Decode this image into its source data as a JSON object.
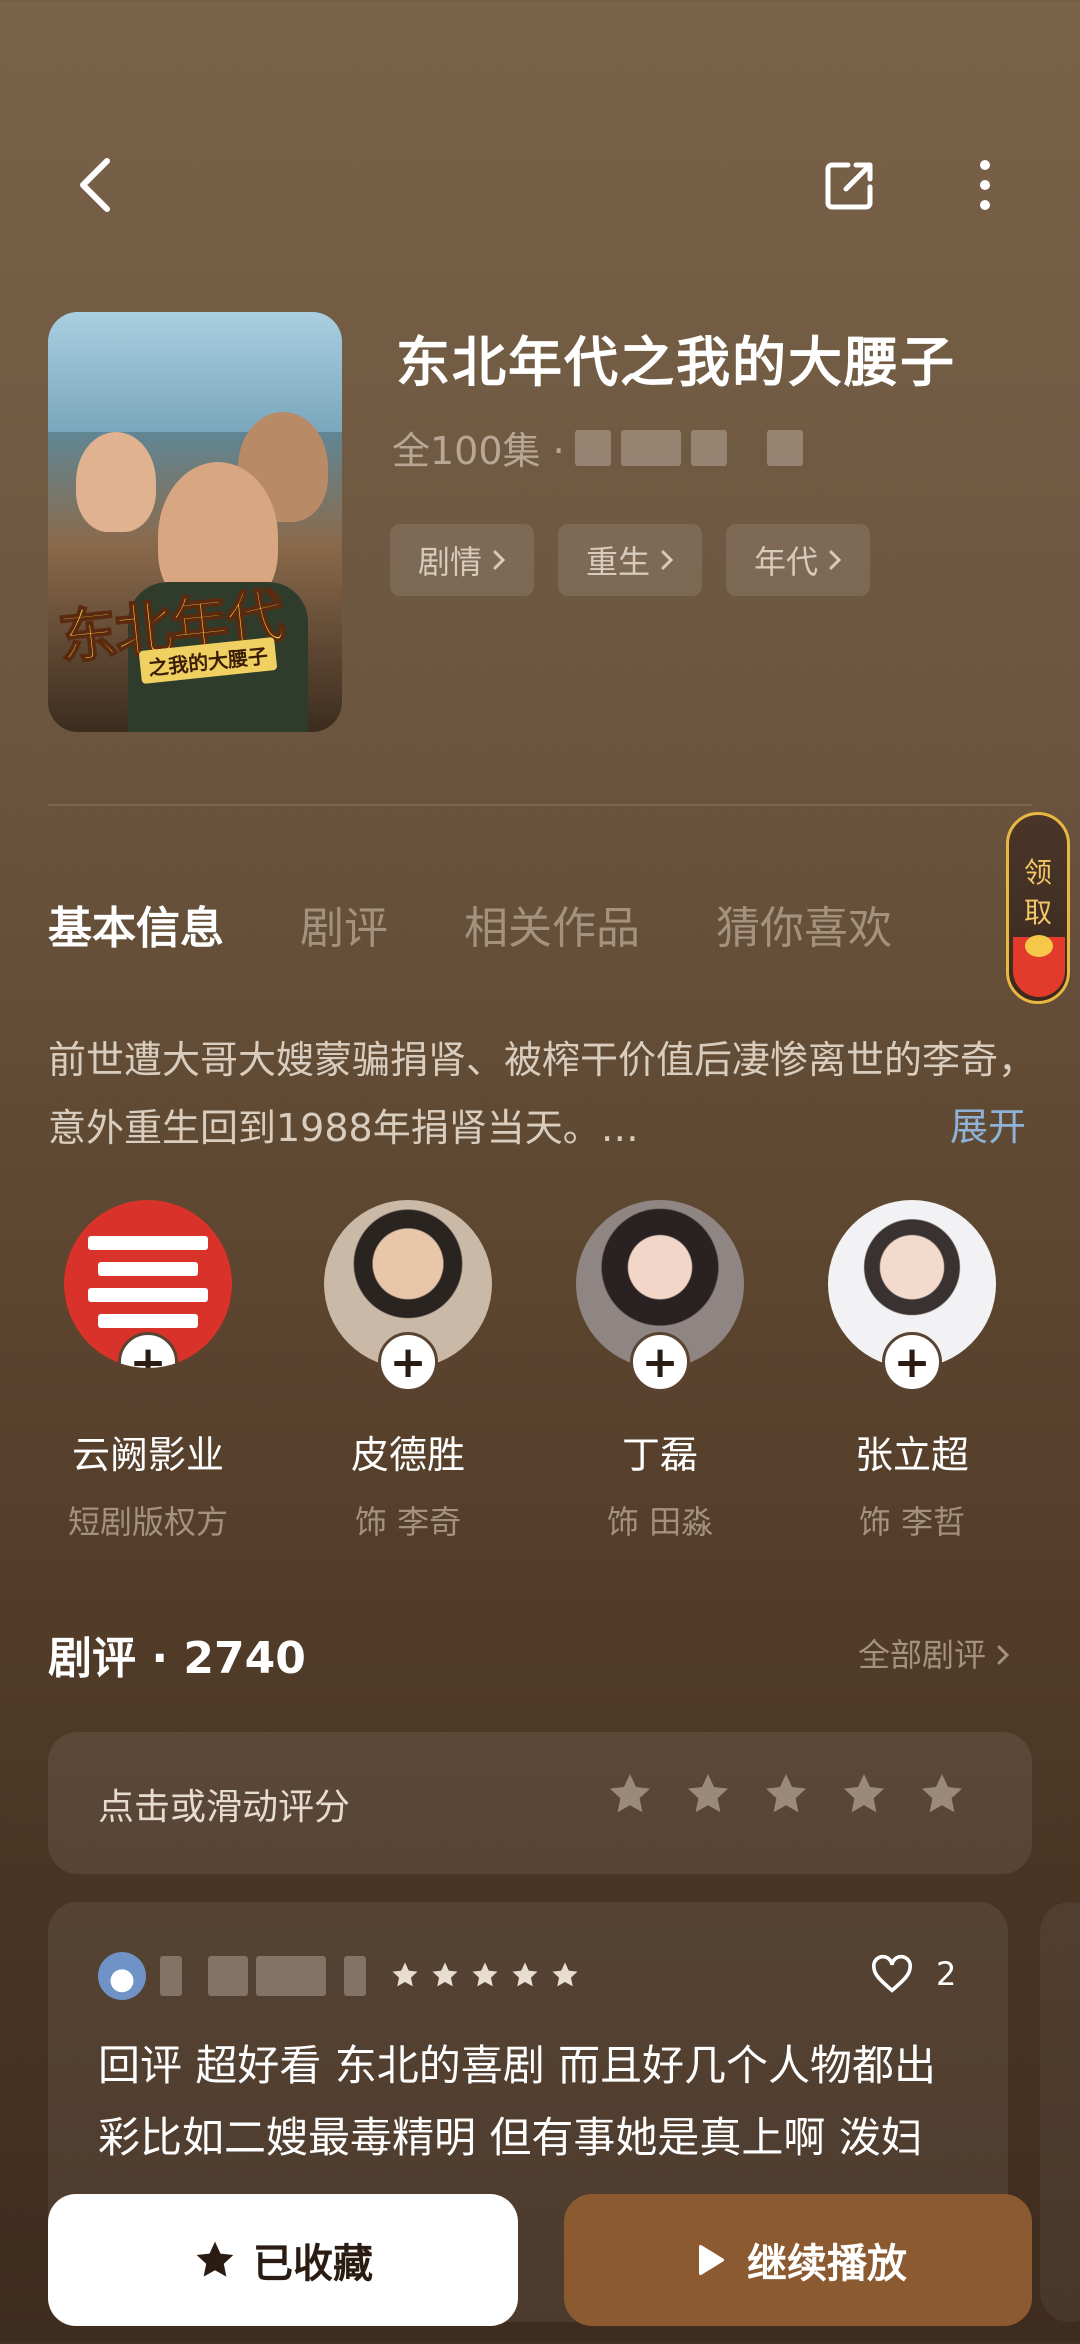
{
  "header": {
    "back_icon": "chevron-left-icon",
    "share_icon": "share-icon",
    "more_icon": "more-vertical-icon"
  },
  "drama": {
    "poster_title": "东北年代",
    "poster_subtitle": "之我的大腰子",
    "title": "东北年代之我的大腰子",
    "episodes": "全100集 ·",
    "tags": [
      "剧情",
      "重生",
      "年代"
    ]
  },
  "tabs": [
    "基本信息",
    "剧评",
    "相关作品",
    "猜你喜欢"
  ],
  "gift": {
    "label_1": "领",
    "label_2": "取"
  },
  "synopsis": {
    "text": "前世遭大哥大嫂蒙骗捐肾、被榨干价值后凄惨离世的李奇，意外重生回到1988年捐肾当天。…",
    "expand": "展开"
  },
  "cast": [
    {
      "name": "云阙影业",
      "role": "短剧版权方"
    },
    {
      "name": "皮德胜",
      "role": "饰 李奇"
    },
    {
      "name": "丁磊",
      "role": "饰 田淼"
    },
    {
      "name": "张立超",
      "role": "饰 李哲"
    }
  ],
  "reviews": {
    "heading": "剧评 · 2740",
    "see_all": "全部剧评",
    "rate_prompt": "点击或滑动评分",
    "card": {
      "likes": "2",
      "text": "回评 超好看 东北的喜剧 而且好几个人物都出彩比如二嫂最毒精明 但有事她是真上啊 泼妇"
    }
  },
  "actions": {
    "favorite": "已收藏",
    "play": "继续播放"
  },
  "colors": {
    "accent": "#8c5a30",
    "expand": "#8fb3d8",
    "gift_border": "#e8b840"
  }
}
